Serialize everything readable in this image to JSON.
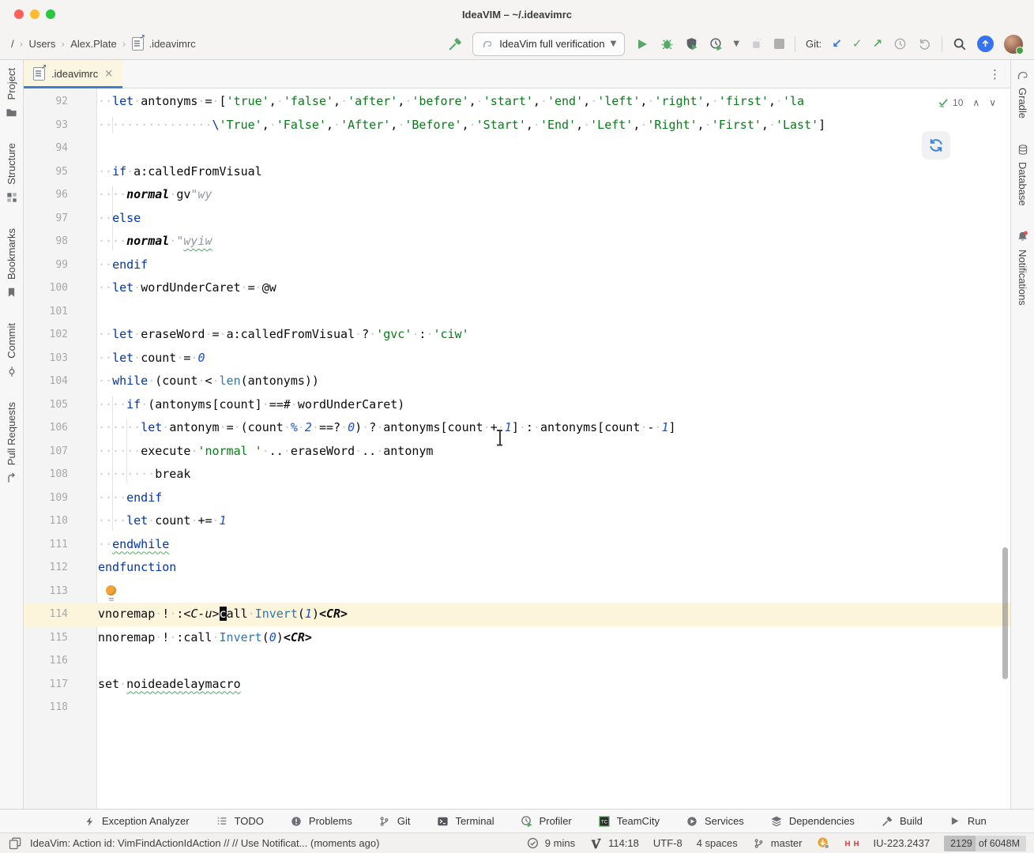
{
  "titlebar": {
    "title": "IdeaVIM – ~/.ideavimrc"
  },
  "toolbar": {
    "breadcrumbs": [
      "/",
      "Users",
      "Alex.Plate",
      ".ideavimrc"
    ],
    "run_config": "IdeaVim full verification",
    "git_label": "Git:",
    "icons": [
      "hammer-icon",
      "run-icon",
      "debug-icon",
      "coverage-icon",
      "profiler-icon",
      "attach-icon",
      "stop-icon",
      "git-update-icon",
      "git-commit-icon",
      "git-push-icon",
      "history-icon",
      "rollback-icon",
      "search-icon",
      "ide-update-icon",
      "avatar"
    ]
  },
  "tab": {
    "label": ".ideavimrc"
  },
  "left_stripe": [
    {
      "name": "project",
      "label": "Project",
      "icon": "folder"
    },
    {
      "name": "structure",
      "label": "Structure",
      "icon": "structure"
    },
    {
      "name": "bookmarks",
      "label": "Bookmarks",
      "icon": "bookmark"
    },
    {
      "name": "commit",
      "label": "Commit",
      "icon": "commit"
    },
    {
      "name": "pull-requests",
      "label": "Pull Requests",
      "icon": "pull-request"
    }
  ],
  "right_stripe": [
    {
      "name": "gradle",
      "label": "Gradle",
      "icon": "gradle"
    },
    {
      "name": "database",
      "label": "Database",
      "icon": "database"
    },
    {
      "name": "notifications",
      "label": "Notifications",
      "icon": "bell"
    }
  ],
  "editor": {
    "inspections_count": "10",
    "caret_line": 114,
    "lines": [
      {
        "n": 92,
        "s": [
          [
            "w",
            "  "
          ],
          [
            "k",
            "let"
          ],
          [
            "w",
            " "
          ],
          [
            "p",
            "antonyms"
          ],
          [
            "w",
            " "
          ],
          [
            "p",
            "="
          ],
          [
            "w",
            " "
          ],
          [
            "p",
            "["
          ],
          [
            "s",
            "'true'"
          ],
          [
            "p",
            ","
          ],
          [
            "w",
            " "
          ],
          [
            "s",
            "'false'"
          ],
          [
            "p",
            ","
          ],
          [
            "w",
            " "
          ],
          [
            "s",
            "'after'"
          ],
          [
            "p",
            ","
          ],
          [
            "w",
            " "
          ],
          [
            "s",
            "'before'"
          ],
          [
            "p",
            ","
          ],
          [
            "w",
            " "
          ],
          [
            "s",
            "'start'"
          ],
          [
            "p",
            ","
          ],
          [
            "w",
            " "
          ],
          [
            "s",
            "'end'"
          ],
          [
            "p",
            ","
          ],
          [
            "w",
            " "
          ],
          [
            "s",
            "'left'"
          ],
          [
            "p",
            ","
          ],
          [
            "w",
            " "
          ],
          [
            "s",
            "'right'"
          ],
          [
            "p",
            ","
          ],
          [
            "w",
            " "
          ],
          [
            "s",
            "'first'"
          ],
          [
            "p",
            ","
          ],
          [
            "w",
            " "
          ],
          [
            "s",
            "'la"
          ]
        ]
      },
      {
        "n": 93,
        "s": [
          [
            "w",
            "                "
          ],
          [
            "k",
            "\\"
          ],
          [
            "s",
            "'True'"
          ],
          [
            "p",
            ","
          ],
          [
            "w",
            " "
          ],
          [
            "s",
            "'False'"
          ],
          [
            "p",
            ","
          ],
          [
            "w",
            " "
          ],
          [
            "s",
            "'After'"
          ],
          [
            "p",
            ","
          ],
          [
            "w",
            " "
          ],
          [
            "s",
            "'Before'"
          ],
          [
            "p",
            ","
          ],
          [
            "w",
            " "
          ],
          [
            "s",
            "'Start'"
          ],
          [
            "p",
            ","
          ],
          [
            "w",
            " "
          ],
          [
            "s",
            "'End'"
          ],
          [
            "p",
            ","
          ],
          [
            "w",
            " "
          ],
          [
            "s",
            "'Left'"
          ],
          [
            "p",
            ","
          ],
          [
            "w",
            " "
          ],
          [
            "s",
            "'Right'"
          ],
          [
            "p",
            ","
          ],
          [
            "w",
            " "
          ],
          [
            "s",
            "'First'"
          ],
          [
            "p",
            ","
          ],
          [
            "w",
            " "
          ],
          [
            "s",
            "'Last'"
          ],
          [
            "p",
            "]"
          ]
        ]
      },
      {
        "n": 94,
        "s": []
      },
      {
        "n": 95,
        "s": [
          [
            "w",
            "  "
          ],
          [
            "k",
            "if"
          ],
          [
            "w",
            " "
          ],
          [
            "p",
            "a:calledFromVisual"
          ]
        ]
      },
      {
        "n": 96,
        "s": [
          [
            "w",
            "    "
          ],
          [
            "c",
            "normal"
          ],
          [
            "w",
            " "
          ],
          [
            "p",
            "gv"
          ],
          [
            "r",
            "\"wy"
          ]
        ]
      },
      {
        "n": 97,
        "s": [
          [
            "w",
            "  "
          ],
          [
            "k",
            "else"
          ]
        ]
      },
      {
        "n": 98,
        "s": [
          [
            "w",
            "    "
          ],
          [
            "c",
            "normal"
          ],
          [
            "w",
            " "
          ],
          [
            "r",
            "\""
          ],
          [
            "rw",
            "wyiw"
          ]
        ]
      },
      {
        "n": 99,
        "s": [
          [
            "w",
            "  "
          ],
          [
            "k",
            "endif"
          ]
        ]
      },
      {
        "n": 100,
        "s": [
          [
            "w",
            "  "
          ],
          [
            "k",
            "let"
          ],
          [
            "w",
            " "
          ],
          [
            "p",
            "wordUnderCaret"
          ],
          [
            "w",
            " "
          ],
          [
            "p",
            "="
          ],
          [
            "w",
            " "
          ],
          [
            "p",
            "@w"
          ]
        ]
      },
      {
        "n": 101,
        "s": []
      },
      {
        "n": 102,
        "s": [
          [
            "w",
            "  "
          ],
          [
            "k",
            "let"
          ],
          [
            "w",
            " "
          ],
          [
            "p",
            "eraseWord"
          ],
          [
            "w",
            " "
          ],
          [
            "p",
            "="
          ],
          [
            "w",
            " "
          ],
          [
            "p",
            "a:calledFromVisual"
          ],
          [
            "w",
            " "
          ],
          [
            "p",
            "?"
          ],
          [
            "w",
            " "
          ],
          [
            "s",
            "'gvc'"
          ],
          [
            "w",
            " "
          ],
          [
            "p",
            ":"
          ],
          [
            "w",
            " "
          ],
          [
            "s",
            "'ciw'"
          ]
        ]
      },
      {
        "n": 103,
        "s": [
          [
            "w",
            "  "
          ],
          [
            "k",
            "let"
          ],
          [
            "w",
            " "
          ],
          [
            "p",
            "count"
          ],
          [
            "w",
            " "
          ],
          [
            "p",
            "="
          ],
          [
            "w",
            " "
          ],
          [
            "n",
            "0"
          ]
        ]
      },
      {
        "n": 104,
        "s": [
          [
            "w",
            "  "
          ],
          [
            "k",
            "while"
          ],
          [
            "w",
            " "
          ],
          [
            "p",
            "(count"
          ],
          [
            "w",
            " "
          ],
          [
            "p",
            "<"
          ],
          [
            "w",
            " "
          ],
          [
            "f",
            "len"
          ],
          [
            "p",
            "(antonyms))"
          ]
        ]
      },
      {
        "n": 105,
        "s": [
          [
            "w",
            "    "
          ],
          [
            "k",
            "if"
          ],
          [
            "w",
            " "
          ],
          [
            "p",
            "(antonyms[count]"
          ],
          [
            "w",
            " "
          ],
          [
            "p",
            "==#"
          ],
          [
            "w",
            " "
          ],
          [
            "p",
            "wordUnderCaret)"
          ]
        ]
      },
      {
        "n": 106,
        "s": [
          [
            "w",
            "      "
          ],
          [
            "k",
            "let"
          ],
          [
            "w",
            " "
          ],
          [
            "p",
            "antonym"
          ],
          [
            "w",
            " "
          ],
          [
            "p",
            "="
          ],
          [
            "w",
            " "
          ],
          [
            "p",
            "(count"
          ],
          [
            "w",
            " "
          ],
          [
            "n",
            "%"
          ],
          [
            "w",
            " "
          ],
          [
            "n",
            "2"
          ],
          [
            "w",
            " "
          ],
          [
            "p",
            "==?"
          ],
          [
            "w",
            " "
          ],
          [
            "n",
            "0"
          ],
          [
            "p",
            ")"
          ],
          [
            "w",
            " "
          ],
          [
            "p",
            "?"
          ],
          [
            "w",
            " "
          ],
          [
            "p",
            "antonyms[count"
          ],
          [
            "w",
            " "
          ],
          [
            "p",
            "+"
          ],
          [
            "w",
            " "
          ],
          [
            "n",
            "1"
          ],
          [
            "p",
            "]"
          ],
          [
            "w",
            " "
          ],
          [
            "p",
            ":"
          ],
          [
            "w",
            " "
          ],
          [
            "p",
            "antonyms[count"
          ],
          [
            "w",
            " "
          ],
          [
            "p",
            "-"
          ],
          [
            "w",
            " "
          ],
          [
            "n",
            "1"
          ],
          [
            "p",
            "]"
          ]
        ]
      },
      {
        "n": 107,
        "s": [
          [
            "w",
            "      "
          ],
          [
            "p",
            "execute"
          ],
          [
            "w",
            " "
          ],
          [
            "s",
            "'normal '"
          ],
          [
            "w",
            " "
          ],
          [
            "p",
            ".."
          ],
          [
            "w",
            " "
          ],
          [
            "p",
            "eraseWord"
          ],
          [
            "w",
            " "
          ],
          [
            "p",
            ".."
          ],
          [
            "w",
            " "
          ],
          [
            "p",
            "antonym"
          ]
        ]
      },
      {
        "n": 108,
        "s": [
          [
            "w",
            "        "
          ],
          [
            "p",
            "break"
          ]
        ]
      },
      {
        "n": 109,
        "s": [
          [
            "w",
            "    "
          ],
          [
            "k",
            "endif"
          ]
        ]
      },
      {
        "n": 110,
        "s": [
          [
            "w",
            "    "
          ],
          [
            "k",
            "let"
          ],
          [
            "w",
            " "
          ],
          [
            "p",
            "count"
          ],
          [
            "w",
            " "
          ],
          [
            "p",
            "+="
          ],
          [
            "w",
            " "
          ],
          [
            "n",
            "1"
          ]
        ]
      },
      {
        "n": 111,
        "s": [
          [
            "w",
            "  "
          ],
          [
            "kw",
            "endwhile"
          ]
        ]
      },
      {
        "n": 112,
        "s": [
          [
            "k",
            "endfunction"
          ]
        ]
      },
      {
        "n": 113,
        "s": []
      },
      {
        "n": 114,
        "s": [
          [
            "p",
            "vnoremap"
          ],
          [
            "w",
            " "
          ],
          [
            "p",
            "!"
          ],
          [
            "w",
            " "
          ],
          [
            "p",
            ":"
          ],
          [
            "i",
            "<C-u>"
          ],
          [
            "cur",
            "c"
          ],
          [
            "p",
            "all"
          ],
          [
            "w",
            " "
          ],
          [
            "f",
            "Invert"
          ],
          [
            "p",
            "("
          ],
          [
            "n",
            "1"
          ],
          [
            "p",
            ")"
          ],
          [
            "bi",
            "<CR>"
          ]
        ]
      },
      {
        "n": 115,
        "s": [
          [
            "p",
            "nnoremap"
          ],
          [
            "w",
            " "
          ],
          [
            "p",
            "!"
          ],
          [
            "w",
            " "
          ],
          [
            "p",
            ":call"
          ],
          [
            "w",
            " "
          ],
          [
            "f",
            "Invert"
          ],
          [
            "p",
            "("
          ],
          [
            "n",
            "0"
          ],
          [
            "p",
            ")"
          ],
          [
            "bi",
            "<CR>"
          ]
        ]
      },
      {
        "n": 116,
        "s": []
      },
      {
        "n": 117,
        "s": [
          [
            "p",
            "set"
          ],
          [
            "w",
            " "
          ],
          [
            "pw",
            "noideadelaymacro"
          ]
        ]
      },
      {
        "n": 118,
        "s": []
      }
    ]
  },
  "bottombar": [
    {
      "name": "exception-analyzer",
      "icon": "lightning",
      "label": "Exception Analyzer"
    },
    {
      "name": "todo",
      "icon": "list",
      "label": "TODO"
    },
    {
      "name": "problems",
      "icon": "error-circle",
      "label": "Problems"
    },
    {
      "name": "git",
      "icon": "branch",
      "label": "Git"
    },
    {
      "name": "terminal",
      "icon": "terminal",
      "label": "Terminal"
    },
    {
      "name": "profiler",
      "icon": "profiler-clock",
      "label": "Profiler"
    },
    {
      "name": "teamcity",
      "icon": "teamcity",
      "label": "TeamCity"
    },
    {
      "name": "services",
      "icon": "services-play",
      "label": "Services"
    },
    {
      "name": "dependencies",
      "icon": "layers",
      "label": "Dependencies"
    },
    {
      "name": "build",
      "icon": "hammer-gray",
      "label": "Build"
    },
    {
      "name": "run",
      "icon": "play-gray",
      "label": "Run"
    }
  ],
  "statusbar": {
    "message": "IdeaVim: Action id: VimFindActionIdAction // // Use Notificat... (moments ago)",
    "items": [
      {
        "name": "session-time",
        "icon": "check-circle",
        "label": "9 mins"
      },
      {
        "name": "caret-position",
        "icon": "vim",
        "label": "114:18"
      },
      {
        "name": "file-encoding",
        "label": "UTF-8"
      },
      {
        "name": "indent-style",
        "label": "4 spaces"
      },
      {
        "name": "git-branch",
        "icon": "branch",
        "label": "master"
      },
      {
        "name": "plugin-update",
        "icon": "plugin-update",
        "label": ""
      },
      {
        "name": "ideavim-toggle",
        "icon": "ideavim",
        "label": ""
      },
      {
        "name": "ide-version",
        "label": "IU-223.2437"
      }
    ],
    "memory": {
      "used": "2129",
      "rest": " of 6048M"
    }
  },
  "colors": {
    "accent_blue": "#3D7FD4",
    "keyword": "#0033B3",
    "string": "#067D17",
    "number": "#1750EB",
    "caret_row": "#FCF5DC",
    "run_green": "#59A869"
  }
}
